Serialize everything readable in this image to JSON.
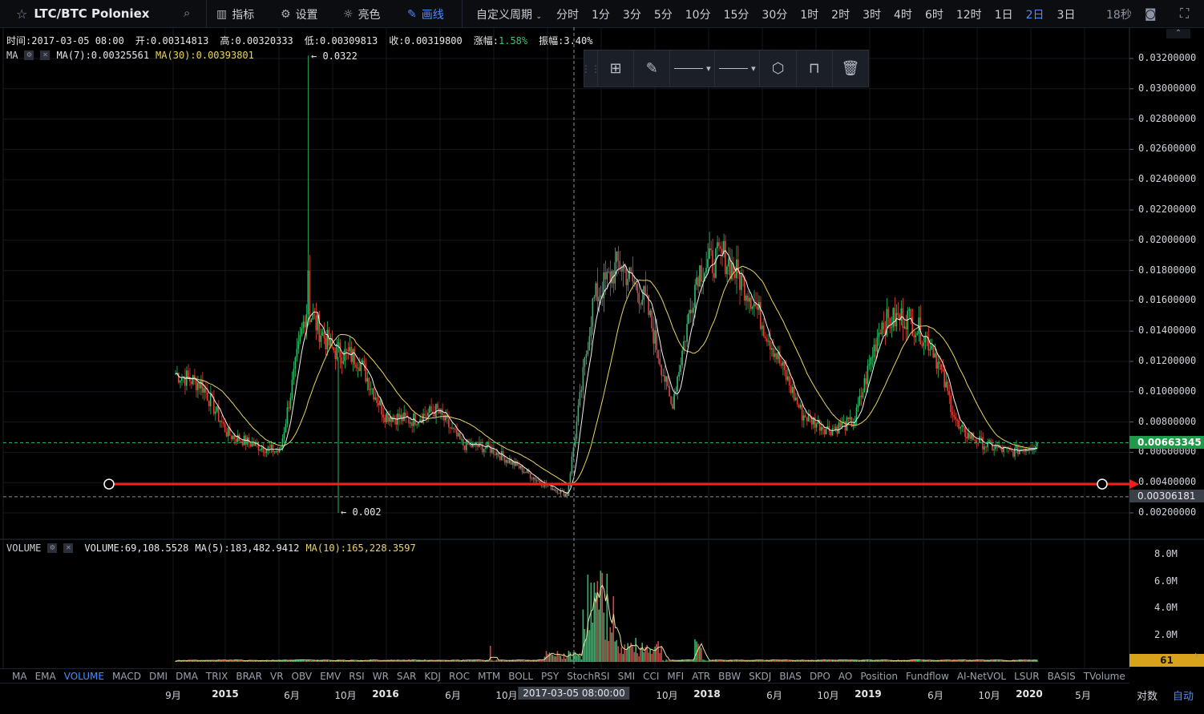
{
  "toolbar": {
    "symbol": "LTC/BTC Poloniex",
    "indicators": "指标",
    "settings": "设置",
    "theme": "亮色",
    "draw": "画线",
    "custom_period": "自定义周期",
    "periods": [
      "分时",
      "1分",
      "3分",
      "5分",
      "10分",
      "15分",
      "30分",
      "1时",
      "2时",
      "3时",
      "4时",
      "6时",
      "12时",
      "1日",
      "2日",
      "3日"
    ],
    "active_period": "2日",
    "refresh": "18秒"
  },
  "info": {
    "time": "时间:2017-03-05 08:00",
    "open": "开:0.00314813",
    "high": "高:0.00320333",
    "low": "低:0.00309813",
    "close": "收:0.00319800",
    "change_label": "涨幅:",
    "change": "1.58%",
    "amplitude": "振幅:3.40%"
  },
  "ma": {
    "name": "MA",
    "ma7": "MA(7):0.00325561",
    "ma30": "MA(30):0.00393801"
  },
  "volume": {
    "name": "VOLUME",
    "value": "VOLUME:69,108.5528",
    "ma5": "MA(5):183,482.9412",
    "ma10": "MA(10):165,228.3597"
  },
  "price_axis": [
    "0.03200000",
    "0.03000000",
    "0.02800000",
    "0.02600000",
    "0.02400000",
    "0.02200000",
    "0.02000000",
    "0.01800000",
    "0.01600000",
    "0.01400000",
    "0.01200000",
    "0.01000000",
    "0.00800000",
    "0.00600000",
    "0.00400000",
    "0.00200000"
  ],
  "volume_axis": [
    "8.0M",
    "6.0M",
    "4.0M",
    "2.0M"
  ],
  "last_price": "0.00663345",
  "crosshair_price": "0.00306181",
  "crosshair_time": "2017-03-05 08:00:00",
  "volume_tag": "61",
  "annotations": {
    "high": "← 0.0322",
    "low": "← 0.002"
  },
  "indicator_tabs": [
    "MA",
    "EMA",
    "VOLUME",
    "MACD",
    "DMI",
    "DMA",
    "TRIX",
    "BRAR",
    "VR",
    "OBV",
    "EMV",
    "RSI",
    "WR",
    "SAR",
    "KDJ",
    "ROC",
    "MTM",
    "BOLL",
    "PSY",
    "StochRSI",
    "SMI",
    "CCI",
    "MFI",
    "ATR",
    "BBW",
    "SKDJ",
    "BIAS",
    "DPO",
    "AO",
    "Position",
    "Fundflow",
    "AI-NetVOL",
    "LSUR",
    "BASIS",
    "TVolume"
  ],
  "active_indicator": "VOLUME",
  "time_axis": [
    "9月",
    "2015",
    "6月",
    "10月",
    "2016",
    "6月",
    "10月",
    "2017-03-05 08:00:00",
    "10月",
    "2018",
    "6月",
    "10月",
    "2019",
    "6月",
    "10月",
    "2020",
    "5月"
  ],
  "scale_log": "对数",
  "scale_auto": "自动",
  "colors": {
    "up": "#2ebd6a",
    "down": "#e2413a",
    "ma7": "#f2f2f2",
    "ma30": "#e8d562",
    "hline": "#ff1a1a",
    "accent": "#4b8dff"
  },
  "chart_data": {
    "type": "candlestick",
    "pair": "LTC/BTC",
    "high_annotation": 0.0322,
    "low_annotation": 0.002,
    "last": 0.00663345,
    "horizontal_line": 0.0039,
    "close_series": [
      [
        "2014-09",
        0.0112
      ],
      [
        "2014-11",
        0.0105
      ],
      [
        "2015-01",
        0.0072
      ],
      [
        "2015-03",
        0.0065
      ],
      [
        "2015-05",
        0.006
      ],
      [
        "2015-07",
        0.0155
      ],
      [
        "2015-09",
        0.0128
      ],
      [
        "2015-11",
        0.0122
      ],
      [
        "2016-01",
        0.0085
      ],
      [
        "2016-03",
        0.0081
      ],
      [
        "2016-05",
        0.0088
      ],
      [
        "2016-07",
        0.0065
      ],
      [
        "2016-09",
        0.0063
      ],
      [
        "2016-11",
        0.0052
      ],
      [
        "2017-01",
        0.004
      ],
      [
        "2017-03",
        0.0032
      ],
      [
        "2017-05",
        0.016
      ],
      [
        "2017-07",
        0.0185
      ],
      [
        "2017-09",
        0.016
      ],
      [
        "2017-11",
        0.009
      ],
      [
        "2018-01",
        0.018
      ],
      [
        "2018-03",
        0.019
      ],
      [
        "2018-05",
        0.0165
      ],
      [
        "2018-07",
        0.0125
      ],
      [
        "2018-09",
        0.0085
      ],
      [
        "2018-11",
        0.0075
      ],
      [
        "2019-01",
        0.008
      ],
      [
        "2019-03",
        0.0145
      ],
      [
        "2019-05",
        0.015
      ],
      [
        "2019-07",
        0.013
      ],
      [
        "2019-09",
        0.0075
      ],
      [
        "2019-11",
        0.0065
      ],
      [
        "2020-01",
        0.006
      ],
      [
        "2020-03",
        0.0066
      ]
    ]
  }
}
